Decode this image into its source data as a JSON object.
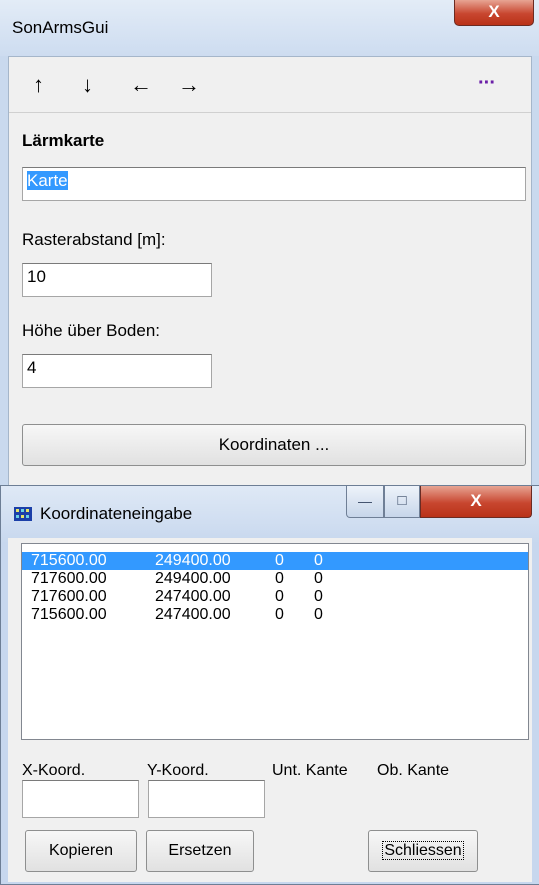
{
  "main_window": {
    "title": "SonArmsGui",
    "close_glyph": "X",
    "toolbar": {
      "up": "↑",
      "down": "↓",
      "left": "←",
      "right": "→",
      "more": "···"
    },
    "section_title": "Lärmkarte",
    "name_value": "Karte",
    "raster_label": "Rasterabstand [m]:",
    "raster_value": "10",
    "height_label": "Höhe über Boden:",
    "height_value": "4",
    "coord_button": "Koordinaten ..."
  },
  "coord_window": {
    "title": "Koordinateneingabe",
    "icon": "app-grid-icon",
    "min_glyph": "—",
    "max_glyph": "□",
    "close_glyph": "X",
    "rows": [
      {
        "x": "715600.00",
        "y": "249400.00",
        "lower": "0",
        "upper": "0"
      },
      {
        "x": "717600.00",
        "y": "249400.00",
        "lower": "0",
        "upper": "0"
      },
      {
        "x": "717600.00",
        "y": "247400.00",
        "lower": "0",
        "upper": "0"
      },
      {
        "x": "715600.00",
        "y": "247400.00",
        "lower": "0",
        "upper": "0"
      }
    ],
    "selected_index": 0,
    "x_label": "X-Koord.",
    "y_label": "Y-Koord.",
    "lower_label": "Unt. Kante",
    "upper_label": "Ob. Kante",
    "x_value": "",
    "y_value": "",
    "copy_button": "Kopieren",
    "replace_button": "Ersetzen",
    "close_button": "Schliessen"
  },
  "colors": {
    "selection": "#3399ff",
    "close_red": "#c8462f"
  }
}
